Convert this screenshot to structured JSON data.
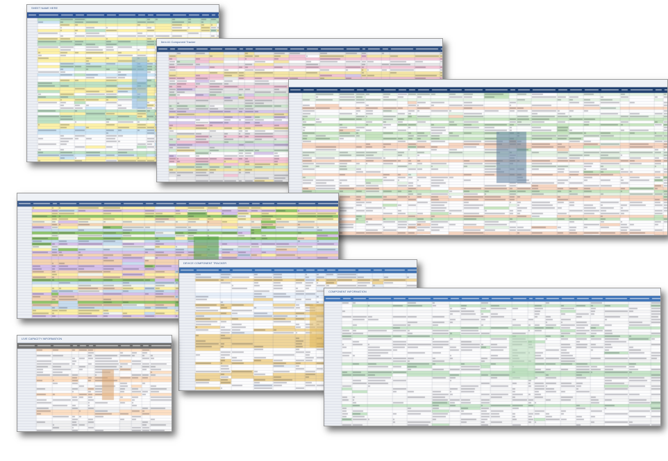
{
  "sheets": [
    {
      "id": "s1",
      "title": "SHEET NAME HERE",
      "subtitle": "",
      "colors": [
        "#ffffff",
        "#cfe8f7",
        "#bfe3c4",
        "#fff3a8",
        "#ffffff"
      ],
      "header_color": "#2f5597",
      "accent": "#7fb0d8"
    },
    {
      "id": "s2",
      "title": "Item #1 Component Tracker",
      "subtitle": "",
      "colors": [
        "#ffffff",
        "#f6e7a6",
        "#d7c7ea",
        "#f5c6d6",
        "#cfe8cf",
        "#e8e8e8"
      ],
      "header_color": "#2f4f7f",
      "accent": "#9fb8d6"
    },
    {
      "id": "s3",
      "title": "",
      "subtitle": "",
      "colors": [
        "#ffffff",
        "#e6f4e4",
        "#ffffff",
        "#f9d7c2",
        "#c8e6c0",
        "#ffffff"
      ],
      "header_color": "#1f3f6f",
      "accent": "#5f7f9f"
    },
    {
      "id": "s4",
      "title": "",
      "subtitle": "",
      "colors": [
        "#f4f8ee",
        "#8fc46a",
        "#c9def0",
        "#f6d5b3",
        "#d9c2ec",
        "#fff2a6"
      ],
      "header_color": "#3a5a8c",
      "accent": "#4f9f3f"
    },
    {
      "id": "s5",
      "title": "DEVICE COMPONENT TRACKER",
      "subtitle": "",
      "colors": [
        "#ffffff",
        "#eaf2fb",
        "#f2d79a",
        "#ffffff"
      ],
      "header_color": "#3b6fb0",
      "accent": "#e2b85a"
    },
    {
      "id": "s6",
      "title": "COMPONENT INFORMATION",
      "subtitle": "",
      "colors": [
        "#ffffff",
        "#f7f7f7",
        "#c8e6c9",
        "#ffffff"
      ],
      "header_color": "#3d73b8",
      "accent": "#b7dcb8"
    },
    {
      "id": "s7",
      "title": "LIVE CAPACITY INFORMATION",
      "subtitle": "",
      "colors": [
        "#ffffff",
        "#f2f2f2",
        "#ffe1c4",
        "#ffffff"
      ],
      "header_color": "#6f6f6f",
      "accent": "#d9a46f"
    }
  ]
}
